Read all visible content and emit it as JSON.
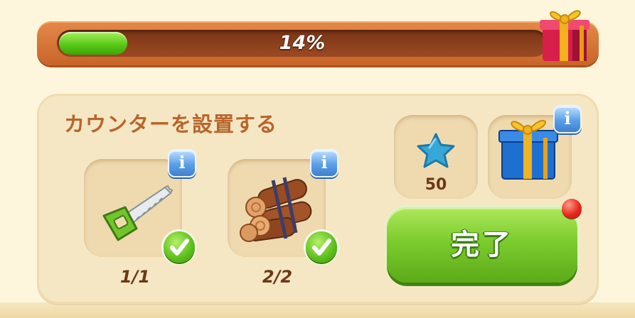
{
  "progress": {
    "percent_label": "14%",
    "fraction": 0.14
  },
  "quest": {
    "title": "カウンターを設置する"
  },
  "requirements": [
    {
      "icon": "saw-icon",
      "count": "1/1",
      "completed": true
    },
    {
      "icon": "logs-icon",
      "count": "2/2",
      "completed": true
    }
  ],
  "rewards": [
    {
      "icon": "blue-star-icon",
      "amount": "50"
    },
    {
      "icon": "blue-gift-box-icon"
    }
  ],
  "info_label": "i",
  "complete_button": {
    "label": "完了"
  },
  "colors": {
    "progress_fill": "#54c614",
    "title": "#b8652d",
    "button": "#7ccc2e",
    "notification": "#e8281c"
  }
}
